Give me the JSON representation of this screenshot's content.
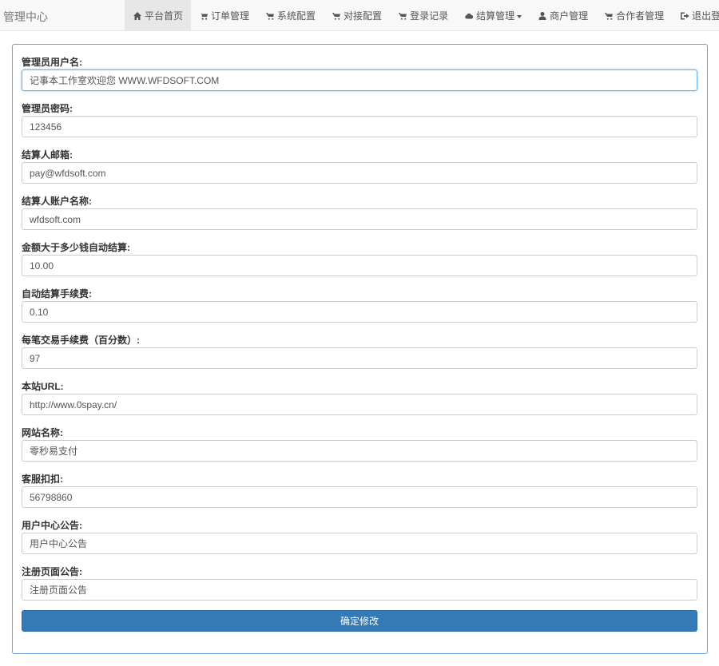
{
  "brand": "管理中心",
  "nav": [
    {
      "label": "平台首页",
      "icon": "home-icon"
    },
    {
      "label": "订单管理",
      "icon": "shopping-cart-icon"
    },
    {
      "label": "系统配置",
      "icon": "shopping-cart-icon"
    },
    {
      "label": "对接配置",
      "icon": "shopping-cart-icon"
    },
    {
      "label": "登录记录",
      "icon": "shopping-cart-icon"
    },
    {
      "label": "结算管理",
      "icon": "cloud-icon"
    },
    {
      "label": "商户管理",
      "icon": "user-icon"
    },
    {
      "label": "合作者管理",
      "icon": "shopping-cart-icon"
    },
    {
      "label": "退出登陆",
      "icon": "logout-icon"
    }
  ],
  "form": {
    "fields": [
      {
        "label": "管理员用户名:",
        "value": "记事本工作室欢迎您 WWW.WFDSOFT.COM"
      },
      {
        "label": "管理员密码:",
        "value": "123456"
      },
      {
        "label": "结算人邮箱:",
        "value": "pay@wfdsoft.com"
      },
      {
        "label": "结算人账户名称:",
        "value": "wfdsoft.com"
      },
      {
        "label": "金额大于多少钱自动结算:",
        "value": "10.00"
      },
      {
        "label": "自动结算手续费:",
        "value": "0.10"
      },
      {
        "label": "每笔交易手续费（百分数）:",
        "value": "97"
      },
      {
        "label": "本站URL:",
        "value": "http://www.0spay.cn/"
      },
      {
        "label": "网站名称:",
        "value": "零秒易支付"
      },
      {
        "label": "客服扣扣:",
        "value": "56798860"
      },
      {
        "label": "用户中心公告:",
        "value": "用户中心公告"
      },
      {
        "label": "注册页面公告:",
        "value": "注册页面公告"
      }
    ],
    "submit_label": "确定修改"
  }
}
